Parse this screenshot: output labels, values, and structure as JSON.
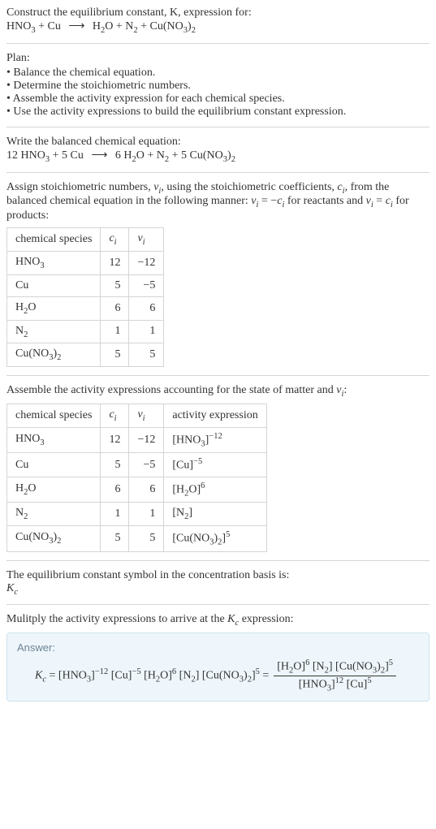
{
  "top": {
    "line1": "Construct the equilibrium constant, K, expression for:",
    "eq_lhs1": "HNO",
    "eq_lhs1_sub": "3",
    "eq_plus1": " + Cu ",
    "arrow": "⟶",
    "eq_rhs1a": " H",
    "eq_rhs1a_sub": "2",
    "eq_rhs1b": "O + N",
    "eq_rhs1b_sub": "2",
    "eq_rhs1c": " + Cu(NO",
    "eq_rhs1c_sub": "3",
    "eq_rhs1d": ")",
    "eq_rhs1d_sub": "2"
  },
  "plan": {
    "title": "Plan:",
    "items": [
      "Balance the chemical equation.",
      "Determine the stoichiometric numbers.",
      "Assemble the activity expression for each chemical species.",
      "Use the activity expressions to build the equilibrium constant expression."
    ]
  },
  "balanced": {
    "title": "Write the balanced chemical equation:",
    "c1": "12 HNO",
    "c1_sub": "3",
    "c2": " + 5 Cu ",
    "arrow": "⟶",
    "c3": " 6 H",
    "c3_sub": "2",
    "c4": "O + N",
    "c4_sub": "2",
    "c5": " + 5 Cu(NO",
    "c5_sub": "3",
    "c6": ")",
    "c6_sub": "2"
  },
  "assign": {
    "text1": "Assign stoichiometric numbers, ",
    "vi": "ν",
    "vi_sub": "i",
    "text2": ", using the stoichiometric coefficients, ",
    "ci": "c",
    "ci_sub": "i",
    "text3": ", from the balanced chemical equation in the following manner: ",
    "eqR1": "ν",
    "eqR2": " = −",
    "eqR3": "c",
    "text4": " for reactants and ",
    "eqP1": "ν",
    "eqP2": " = ",
    "eqP3": "c",
    "text5": " for products:"
  },
  "table1": {
    "headers": {
      "h1": "chemical species",
      "h2": "c",
      "h2_sub": "i",
      "h3": "ν",
      "h3_sub": "i"
    },
    "rows": [
      {
        "sp_a": "HNO",
        "sp_sub": "3",
        "sp_b": "",
        "c": "12",
        "v": "−12"
      },
      {
        "sp_a": "Cu",
        "sp_sub": "",
        "sp_b": "",
        "c": "5",
        "v": "−5"
      },
      {
        "sp_a": "H",
        "sp_sub": "2",
        "sp_b": "O",
        "c": "6",
        "v": "6"
      },
      {
        "sp_a": "N",
        "sp_sub": "2",
        "sp_b": "",
        "c": "1",
        "v": "1"
      },
      {
        "sp_a": "Cu(NO",
        "sp_sub": "3",
        "sp_b": ")",
        "sp_sub2": "2",
        "c": "5",
        "v": "5"
      }
    ]
  },
  "assemble": {
    "text1": "Assemble the activity expressions accounting for the state of matter and ",
    "vi": "ν",
    "vi_sub": "i",
    "text2": ":"
  },
  "table2": {
    "headers": {
      "h1": "chemical species",
      "h2": "c",
      "h2_sub": "i",
      "h3": "ν",
      "h3_sub": "i",
      "h4": "activity expression"
    },
    "rows": [
      {
        "sp_a": "HNO",
        "sp_sub": "3",
        "sp_b": "",
        "c": "12",
        "v": "−12",
        "ae_a": "[HNO",
        "ae_sub": "3",
        "ae_b": "]",
        "ae_sup": "−12"
      },
      {
        "sp_a": "Cu",
        "sp_sub": "",
        "sp_b": "",
        "c": "5",
        "v": "−5",
        "ae_a": "[Cu]",
        "ae_sub": "",
        "ae_b": "",
        "ae_sup": "−5"
      },
      {
        "sp_a": "H",
        "sp_sub": "2",
        "sp_b": "O",
        "c": "6",
        "v": "6",
        "ae_a": "[H",
        "ae_sub": "2",
        "ae_b": "O]",
        "ae_sup": "6"
      },
      {
        "sp_a": "N",
        "sp_sub": "2",
        "sp_b": "",
        "c": "1",
        "v": "1",
        "ae_a": "[N",
        "ae_sub": "2",
        "ae_b": "]",
        "ae_sup": ""
      },
      {
        "sp_a": "Cu(NO",
        "sp_sub": "3",
        "sp_b": ")",
        "sp_sub2": "2",
        "c": "5",
        "v": "5",
        "ae_a": "[Cu(NO",
        "ae_sub": "3",
        "ae_b": ")",
        "ae_sub2": "2",
        "ae_c": "]",
        "ae_sup": "5"
      }
    ]
  },
  "symbol": {
    "line1": "The equilibrium constant symbol in the concentration basis is:",
    "K": "K",
    "K_sub": "c"
  },
  "multiply": {
    "text1": "Mulitply the activity expressions to arrive at the ",
    "K": "K",
    "K_sub": "c",
    "text2": " expression:"
  },
  "answer": {
    "label": "Answer:",
    "Kc": "K",
    "Kc_sub": "c",
    "eq": " = ",
    "t1": "[HNO",
    "t1_sub": "3",
    "t1b": "]",
    "t1_sup": "−12",
    "t2": " [Cu]",
    "t2_sup": "−5",
    "t3": " [H",
    "t3_sub": "2",
    "t3b": "O]",
    "t3_sup": "6",
    "t4": " [N",
    "t4_sub": "2",
    "t4b": "]",
    "t5": " [Cu(NO",
    "t5_sub": "3",
    "t5b": ")",
    "t5_sub2": "2",
    "t5c": "]",
    "t5_sup": "5",
    "eq2": " = ",
    "num_a": "[H",
    "num_a_sub": "2",
    "num_ab": "O]",
    "num_a_sup": "6",
    "num_b": " [N",
    "num_b_sub": "2",
    "num_bb": "]",
    "num_c": " [Cu(NO",
    "num_c_sub": "3",
    "num_cb": ")",
    "num_c_sub2": "2",
    "num_cc": "]",
    "num_c_sup": "5",
    "den_a": "[HNO",
    "den_a_sub": "3",
    "den_ab": "]",
    "den_a_sup": "12",
    "den_b": " [Cu]",
    "den_b_sup": "5"
  }
}
